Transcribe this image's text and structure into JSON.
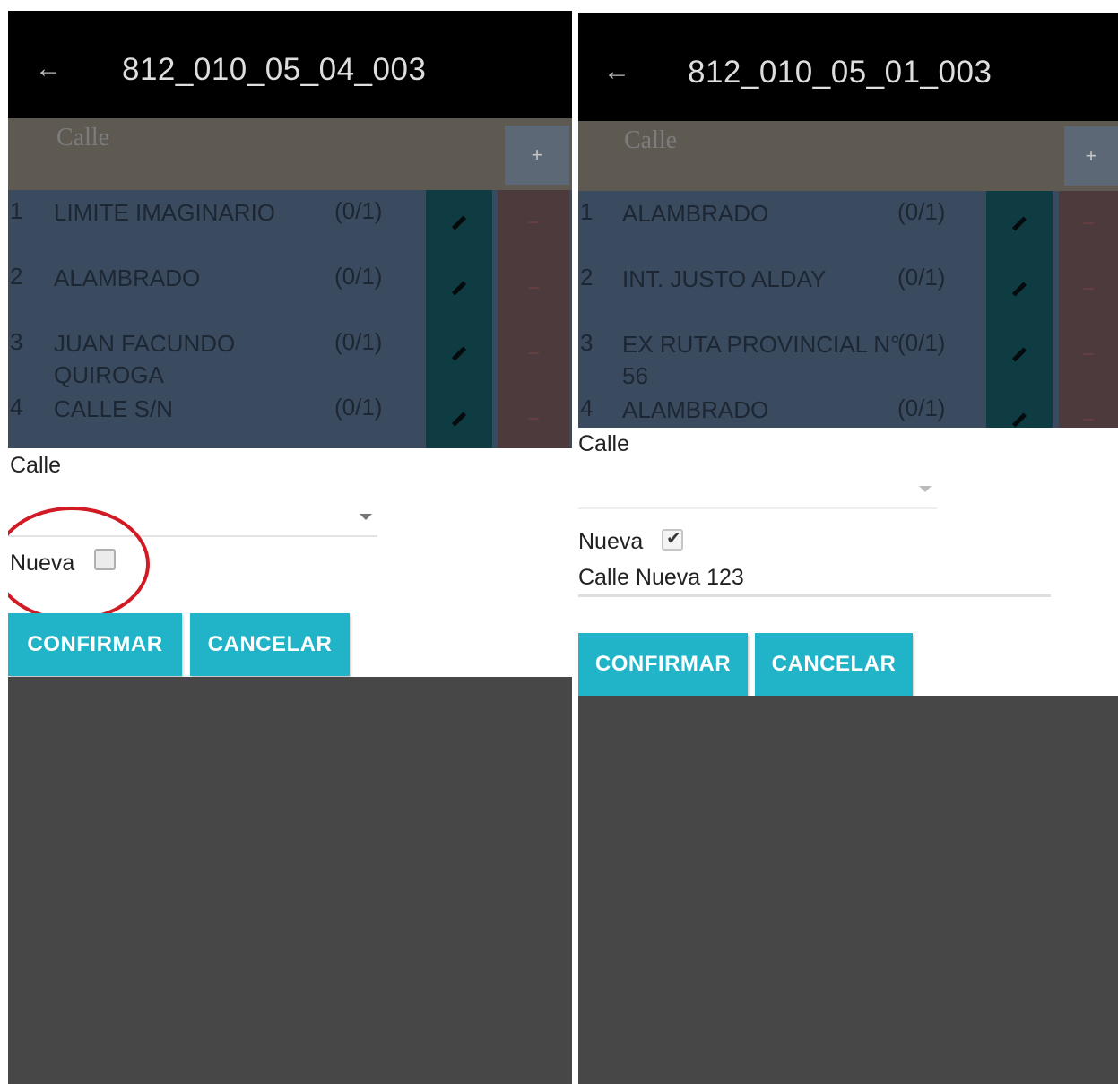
{
  "left": {
    "title": "812_010_05_04_003",
    "header_label": "Calle",
    "plus_label": "+",
    "rows": [
      {
        "num": "1",
        "name": "LIMITE IMAGINARIO",
        "count": "(0/1)"
      },
      {
        "num": "2",
        "name": "ALAMBRADO",
        "count": "(0/1)"
      },
      {
        "num": "3",
        "name": "JUAN FACUNDO QUIROGA",
        "count": "(0/1)"
      },
      {
        "num": "4",
        "name": "CALLE S/N",
        "count": "(0/1)"
      }
    ],
    "delete_label": "−",
    "calle_label": "Calle",
    "nueva_label": "Nueva",
    "nueva_checked": false,
    "confirm_label": "CONFIRMAR",
    "cancel_label": "CANCELAR",
    "highlight_color": "#d11a24"
  },
  "right": {
    "title": "812_010_05_01_003",
    "header_label": "Calle",
    "plus_label": "+",
    "rows": [
      {
        "num": "1",
        "name": "ALAMBRADO",
        "count": "(0/1)"
      },
      {
        "num": "2",
        "name": "INT. JUSTO ALDAY",
        "count": "(0/1)"
      },
      {
        "num": "3",
        "name": "EX RUTA PROVINCIAL N° 56",
        "count": "(0/1)"
      },
      {
        "num": "4",
        "name": "ALAMBRADO",
        "count": "(0/1)"
      }
    ],
    "delete_label": "−",
    "calle_label": "Calle",
    "nueva_label": "Nueva",
    "nueva_checked": true,
    "nueva_value": "Calle Nueva 123",
    "confirm_label": "CONFIRMAR",
    "cancel_label": "CANCELAR"
  },
  "colors": {
    "accent": "#21b4c9",
    "appbar": "#000000",
    "overlay": "#474748"
  },
  "icons": {
    "back": "arrow-left",
    "edit": "pencil",
    "dropdown": "caret-down",
    "check": "check-mark"
  }
}
